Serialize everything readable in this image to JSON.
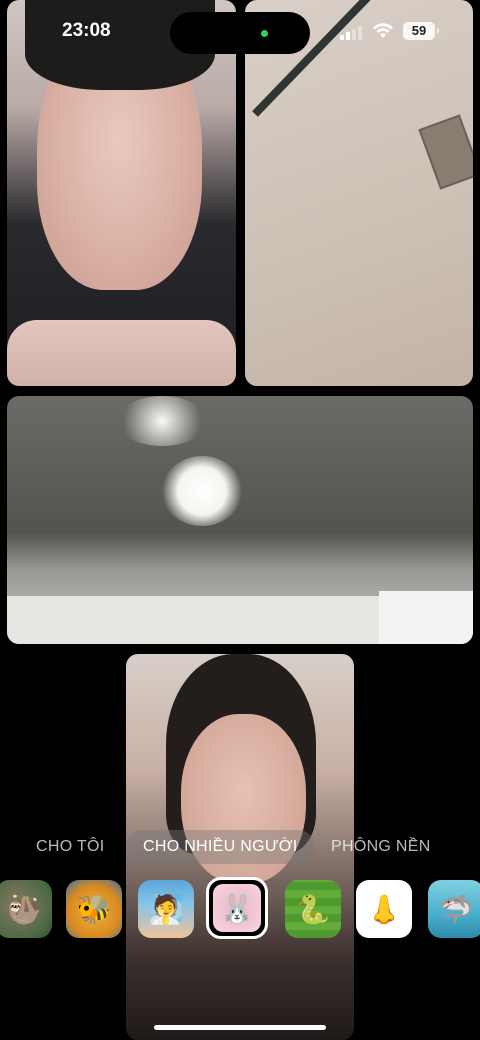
{
  "status_bar": {
    "time": "23:08",
    "battery_level": "59",
    "icons": [
      "signal-icon",
      "wifi-icon",
      "battery-icon"
    ],
    "camera_indicator_color": "#2fd15a"
  },
  "call": {
    "participant_tiles": [
      "participant-video-1",
      "participant-video-2",
      "participant-video-3",
      "self-view-video"
    ]
  },
  "effects_tabs": [
    {
      "label": "CHO TÔI",
      "selected": false
    },
    {
      "label": "CHO NHIỀU NGƯỜI",
      "selected": true
    },
    {
      "label": "PHÔNG NỀN",
      "selected": false
    }
  ],
  "effects": [
    {
      "icon": "sloth-effect-icon",
      "glyph": "🦥"
    },
    {
      "icon": "bees-effect-icon",
      "glyph": "🐝"
    },
    {
      "icon": "face-mask-effect-icon",
      "glyph": "🧖"
    },
    {
      "icon": "bunny-frame-effect-icon",
      "glyph": "🐰",
      "selected": true
    },
    {
      "icon": "snakes-ladders-effect-icon",
      "glyph": "🐍"
    },
    {
      "icon": "big-nose-effect-icon",
      "glyph": "👃"
    },
    {
      "icon": "shark-effect-icon",
      "glyph": "🦈"
    }
  ]
}
